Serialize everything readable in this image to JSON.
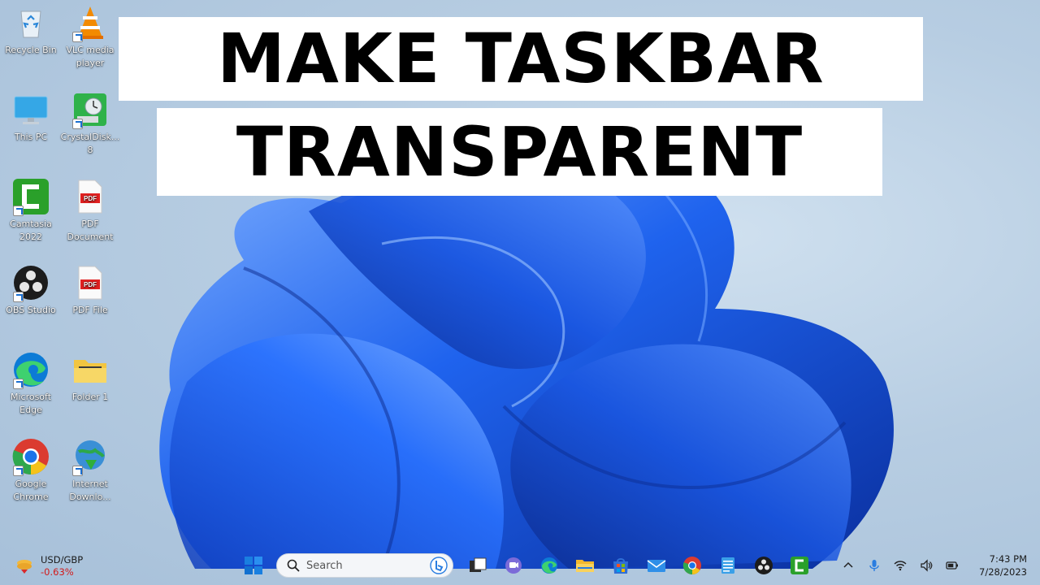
{
  "title": {
    "line1": "MAKE TASKBAR",
    "line2": "TRANSPARENT"
  },
  "desktop_icons": [
    {
      "label": "Recycle Bin",
      "icon": "recycle-bin-icon"
    },
    {
      "label": "VLC media player",
      "icon": "vlc-icon"
    },
    {
      "label": "This PC",
      "icon": "this-pc-icon"
    },
    {
      "label": "CrystalDisk... 8",
      "icon": "crystaldisk-icon"
    },
    {
      "label": "Camtasia 2022",
      "icon": "camtasia-icon"
    },
    {
      "label": "PDF Document",
      "icon": "pdf-icon"
    },
    {
      "label": "OBS Studio",
      "icon": "obs-icon"
    },
    {
      "label": "PDF File",
      "icon": "pdf-icon"
    },
    {
      "label": "Microsoft Edge",
      "icon": "edge-icon"
    },
    {
      "label": "Folder 1",
      "icon": "folder-icon"
    },
    {
      "label": "Google Chrome",
      "icon": "chrome-icon"
    },
    {
      "label": "Internet Downlo...",
      "icon": "internet-download-icon"
    }
  ],
  "taskbar": {
    "widget": {
      "name": "USD/GBP",
      "value": "-0.63%",
      "icon": "currency-widget-icon"
    },
    "search": {
      "placeholder": "Search"
    },
    "pinned": [
      "start-icon",
      "task-view-icon",
      "teams-chat-icon",
      "edge-icon",
      "file-explorer-icon",
      "store-icon",
      "mail-icon",
      "chrome-icon",
      "notepad-icon",
      "obs-icon",
      "camtasia-icon"
    ],
    "tray": [
      "chevron-up-icon",
      "microphone-icon",
      "wifi-icon",
      "volume-icon",
      "battery-icon"
    ],
    "time": "7:43 PM",
    "date": "7/28/2023"
  },
  "colors": {
    "wallpaper_blue": "#1e5ee6",
    "widget_negative": "#d21a1a",
    "banner_bg": "#ffffff"
  }
}
